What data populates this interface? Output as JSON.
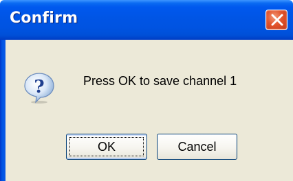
{
  "window": {
    "title": "Confirm",
    "close_icon": "close-icon"
  },
  "dialog": {
    "icon": "question-icon",
    "message": "Press OK to save channel 1"
  },
  "buttons": {
    "ok_label": "OK",
    "cancel_label": "Cancel"
  },
  "colors": {
    "titlebar": "#0055e5",
    "client_bg": "#ece9d8",
    "close_button": "#e2532a"
  }
}
